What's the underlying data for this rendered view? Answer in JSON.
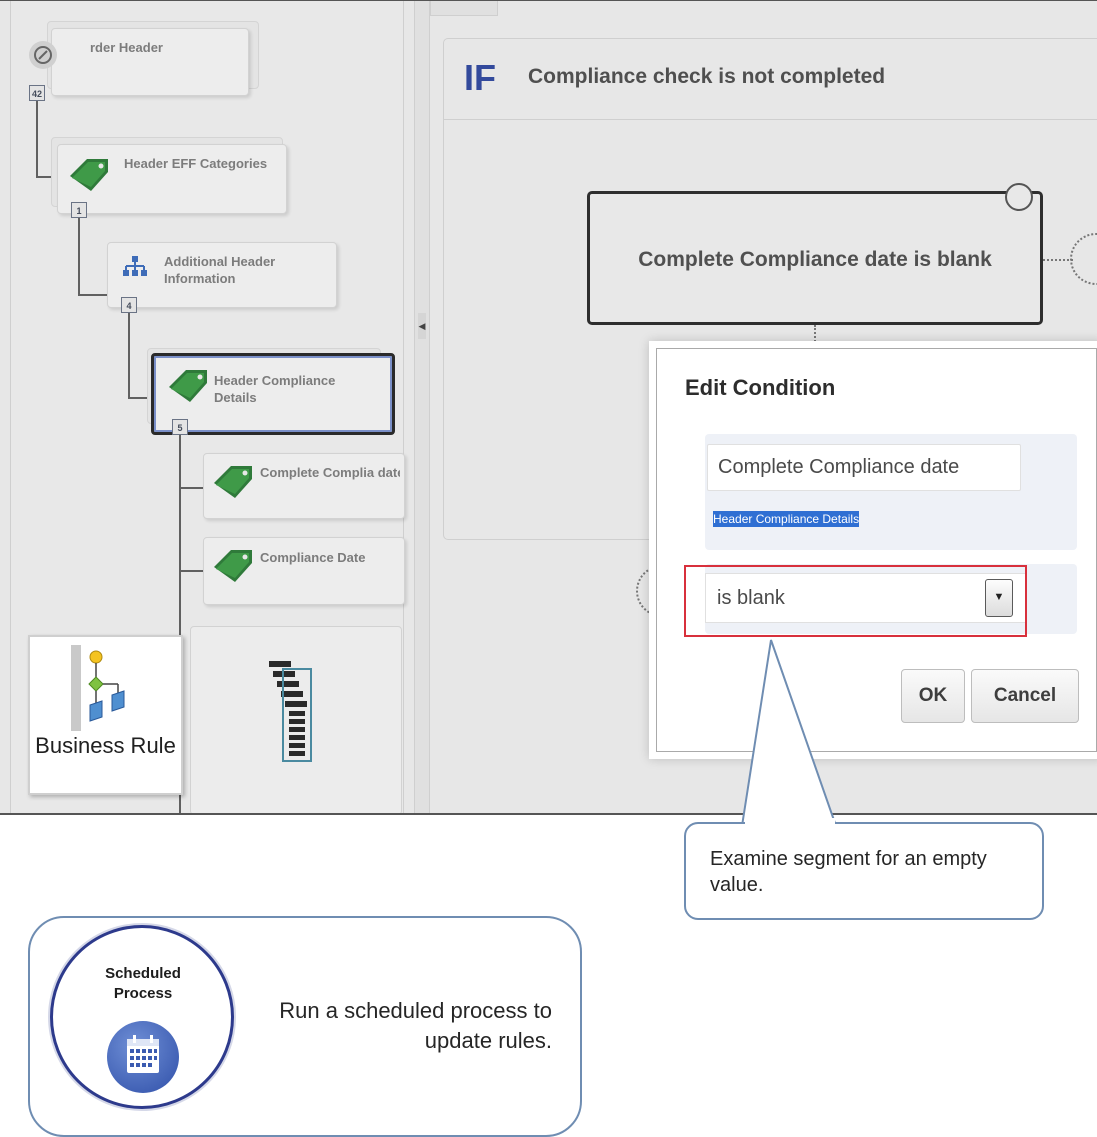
{
  "tree": {
    "nodes": [
      {
        "label": "rder Header",
        "count": "42"
      },
      {
        "label": "Header EFF Categories",
        "count": "1"
      },
      {
        "label": "Additional Header Information",
        "count": "4"
      },
      {
        "label": "Header Compliance Details",
        "count": "5"
      },
      {
        "label": "Complete Complia date"
      },
      {
        "label": "Compliance Date"
      }
    ]
  },
  "tiles": {
    "business_rule": "Business Rule"
  },
  "rule": {
    "keyword": "IF",
    "condition": "Compliance check is not completed",
    "box_text": "Complete Compliance date is blank"
  },
  "dialog": {
    "title": "Edit Condition",
    "field_value": "Complete Compliance date",
    "object_link": "Header Compliance Details",
    "operator": "is blank",
    "ok": "OK",
    "cancel": "Cancel"
  },
  "callouts": {
    "segment_note": "Examine segment for an empty value.",
    "scheduled_process_name": "Scheduled Process",
    "scheduled_process_note": "Run a scheduled process to update rules."
  },
  "colors": {
    "if_keyword": "#334a9c",
    "highlight_border": "#d8303c",
    "callout_border": "#6f8db2",
    "selection": "#2f6fd3",
    "tag_green": "#2f7a3a"
  }
}
